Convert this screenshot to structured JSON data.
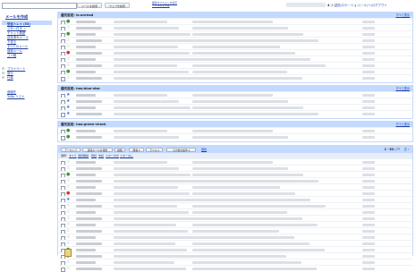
{
  "header": {
    "search_button": "メールを検索",
    "web_search_button": "ウェブを検索",
    "search_options_lines": [
      "検索オプションを表示",
      "フィルタを作成"
    ],
    "top_links": [
      "4",
      "1",
      "送信",
      "ロ",
      "ケーション",
      "ール",
      "ヘ",
      "ログアウト"
    ]
  },
  "sidebar": {
    "compose": "メールを作成",
    "items": [
      {
        "label": "受信トレイ (53)",
        "selected": true
      },
      {
        "label": "スター付き"
      },
      {
        "label": "チャット履歴"
      },
      {
        "label": "送信済みメール"
      },
      {
        "label": "下書き"
      },
      {
        "label": "すべてのメール"
      },
      {
        "label": "迷惑メール"
      },
      {
        "label": "ゴミ箱"
      }
    ],
    "labels": [
      {
        "label": "プライベート"
      },
      {
        "label": "旅行"
      },
      {
        "label": "仕事"
      }
    ],
    "bottom": [
      "連絡先",
      "ToDo リスト"
    ]
  },
  "panels": [
    {
      "title": "優先設定: is:unread",
      "view_all": "すべて表示",
      "rows": 10
    },
    {
      "title": "優先設定: has:blue-star",
      "view_all": "すべて表示",
      "rows": 4
    },
    {
      "title": "優先設定: has:green-check",
      "view_all": "すべて表示",
      "rows": 2
    }
  ],
  "inbox": {
    "buttons": [
      "アーカイブ",
      "迷惑メールを報告",
      "削除",
      "移動 ▾",
      "ラベル ▾",
      "その他の操作 ▾"
    ],
    "refresh": "更新",
    "count_prefix": "1 - 50",
    "count_suffix": " / 77",
    "next": "古 ›",
    "select_label": "選択:",
    "select_links": [
      "すべて",
      "選択解除",
      "既読",
      "未読",
      "スター付き",
      "スターなし"
    ],
    "rows": 18
  },
  "colors": {
    "header_blue": "#c3d9ff",
    "link": "#1c3fa8",
    "star_yellow": "#e8b619",
    "star_blue": "#3b73d6",
    "check_green": "#3a9a3a",
    "important_red": "#d23b2e"
  }
}
